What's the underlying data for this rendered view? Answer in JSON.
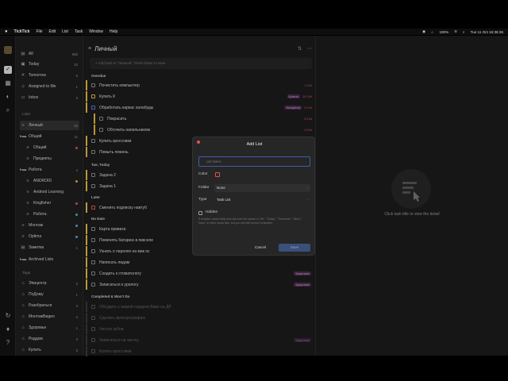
{
  "menubar": {
    "apple": "",
    "app": "TickTick",
    "items": [
      "File",
      "Edit",
      "List",
      "Task",
      "Window",
      "Help"
    ],
    "battery": "100%",
    "datetime": "Tue 11 Oct  16:36:36"
  },
  "sidebar": {
    "smart": [
      {
        "label": "All",
        "count": "583"
      },
      {
        "label": "Today",
        "count": "23"
      },
      {
        "label": "Tomorrow",
        "count": "0"
      },
      {
        "label": "Assigned to Me",
        "count": "1"
      },
      {
        "label": "Inbox",
        "count": "3"
      }
    ],
    "lists_header": "Lists",
    "lists": [
      {
        "label": "Личный",
        "count": "16"
      },
      {
        "label": "Общий",
        "count": "11"
      },
      {
        "label": "Общий",
        "count": ""
      },
      {
        "label": "Предикты",
        "count": ""
      },
      {
        "label": "Работа",
        "count": "4"
      },
      {
        "label": "ANDROID",
        "count": ""
      },
      {
        "label": "Android Learning",
        "count": ""
      },
      {
        "label": "Kingfisher",
        "count": ""
      },
      {
        "label": "Работа",
        "count": ""
      },
      {
        "label": "Монтаж",
        "count": ""
      },
      {
        "label": "Optima",
        "count": ""
      },
      {
        "label": "Заметки",
        "count": "1"
      },
      {
        "label": "Archived Lists",
        "count": ""
      }
    ],
    "tags_header": "Tags",
    "tags": [
      {
        "label": "Эпицентр",
        "count": "2"
      },
      {
        "label": "ПоДому",
        "count": "1"
      },
      {
        "label": "Разобраться",
        "count": "4"
      },
      {
        "label": "МонтажВидео",
        "count": "4"
      },
      {
        "label": "Здоровье",
        "count": "1"
      },
      {
        "label": "Роддом",
        "count": "4"
      },
      {
        "label": "Купить",
        "count": "3"
      }
    ]
  },
  "main": {
    "title": "Личный",
    "add_placeholder": "+ Add task to \"Личный\", Press Enter to save",
    "sections": {
      "overdue": "Overdue",
      "tue_today": "Tue, Today",
      "later": "Later",
      "no_date": "No Date",
      "completed": "Completed & Won't Do"
    },
    "tasks": [
      {
        "text": "Почистить компьютер",
        "tag": "",
        "date": "1 Oct"
      },
      {
        "text": "Купить К",
        "tag": "Купить",
        "date": "15 Oct"
      },
      {
        "text": "Обработать каркас халабуды",
        "tag": "Эпицентр",
        "date": "5 Oct"
      },
      {
        "text": "Покрасить",
        "tag": "",
        "date": "8 Oct"
      },
      {
        "text": "Обточить напильником",
        "tag": "",
        "date": "8 Oct"
      },
      {
        "text": "Купить кроссовки",
        "tag": "",
        "date": "9 Oct"
      },
      {
        "text": "Помыть пожень",
        "tag": "",
        "date": "10 Oct"
      },
      {
        "text": "Задача 2",
        "tag": "",
        "date": ""
      },
      {
        "text": "Задача 1",
        "tag": "",
        "date": ""
      },
      {
        "text": "Сменить подписку навтуб",
        "tag": "",
        "date": ""
      },
      {
        "text": "Карта привата",
        "tag": "",
        "date": ""
      },
      {
        "text": "Поменять батарею в пикселе",
        "tag": "",
        "date": ""
      },
      {
        "text": "Узнать о паролях на мак ос",
        "tag": "",
        "date": ""
      },
      {
        "text": "Написать лидам",
        "tag": "",
        "date": ""
      },
      {
        "text": "Сходить к стоматологу",
        "tag": "Здоровье",
        "date": ""
      },
      {
        "text": "Записаться к урологу",
        "tag": "Здоровье",
        "date": ""
      }
    ],
    "completed_tasks": [
      {
        "text": "Обсудить с мамой подарок Ваве на ДР",
        "tag": ""
      },
      {
        "text": "Сделать флюорографию",
        "tag": ""
      },
      {
        "text": "Чистка зубов",
        "tag": ""
      },
      {
        "text": "Записаться на чистку",
        "tag": "Здоровье"
      },
      {
        "text": "Купить кроссовки",
        "tag": ""
      }
    ]
  },
  "detail": {
    "hint": "Click task title to view the detail"
  },
  "modal": {
    "title": "Add List",
    "name_placeholder": "List Name",
    "color_label": "Color",
    "folder_label": "Folder",
    "folder_value": "None",
    "type_label": "Type",
    "type_value": "Task List",
    "hidden_label": "Hidden",
    "hidden_note": "If enabled, tasks within this list won't be shown in \"All\", \"Today\", \"Tomorrow\", \"Next 7 Days\" or other smart lists, but you will still receive reminders.",
    "cancel": "Cancel",
    "save": "Save",
    "accent": "#4a72d8",
    "color_selected": "#e5534b"
  }
}
